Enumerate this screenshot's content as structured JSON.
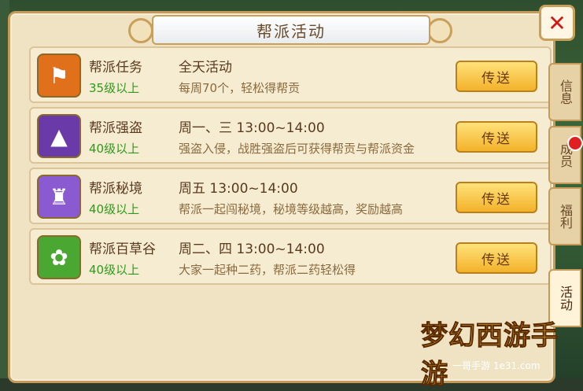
{
  "dialog": {
    "title": "帮派活动"
  },
  "activities": [
    {
      "name": "帮派任务",
      "level": "35级以上",
      "time": "全天活动",
      "desc": "每周70个，轻松得帮贡",
      "button": "传送",
      "icon": "banner-icon",
      "icon_color": "#e0701a"
    },
    {
      "name": "帮派强盗",
      "level": "40级以上",
      "time": "周一、三 13:00~14:00",
      "desc": "强盗入侵，战胜强盗后可获得帮贡与帮派资金",
      "button": "传送",
      "icon": "bandit-icon",
      "icon_color": "#6a3aa8"
    },
    {
      "name": "帮派秘境",
      "level": "40级以上",
      "time": "周五 13:00~14:00",
      "desc": "帮派一起闯秘境，秘境等级越高，奖励越高",
      "button": "传送",
      "icon": "pagoda-icon",
      "icon_color": "#8a5ad0"
    },
    {
      "name": "帮派百草谷",
      "level": "40级以上",
      "time": "周二、四 13:00~14:00",
      "desc": "大家一起种二药，帮派二药轻松得",
      "button": "传送",
      "icon": "herb-leaf-icon",
      "icon_color": "#4aa832"
    }
  ],
  "side_tabs": [
    "信息",
    "成员",
    "福利",
    "活动"
  ],
  "watermark": {
    "title": "梦幻西游手游",
    "sub": "一哥手游 1e31.com"
  }
}
